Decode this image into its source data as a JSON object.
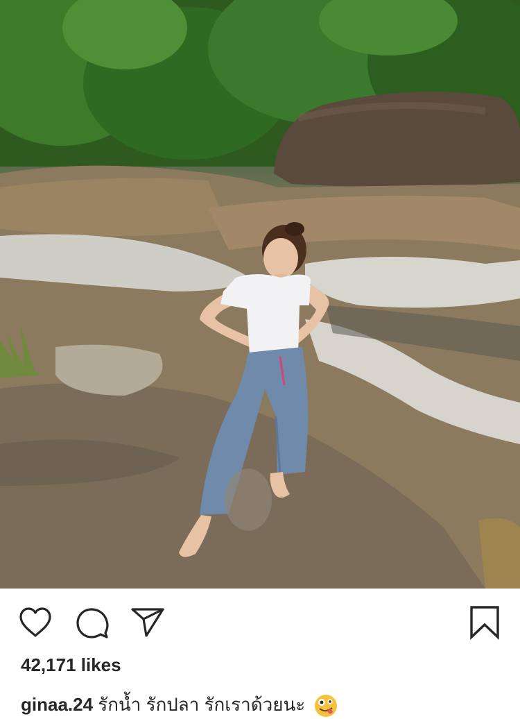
{
  "post": {
    "image_alt": "Woman in white t-shirt and blue pants standing barefoot on rocks by a flowing stream",
    "likes_text": "42,171 likes",
    "username": "ginaa.24",
    "caption_text": "รักน้ำ รักปลา รักเราด้วยนะ",
    "caption_emoji_icon": "zany-face-emoji-icon"
  },
  "actions": {
    "like_icon": "heart-icon",
    "comment_icon": "comment-bubble-icon",
    "share_icon": "paper-plane-icon",
    "save_icon": "bookmark-icon"
  },
  "colors": {
    "text": "#262626",
    "background": "#ffffff"
  }
}
